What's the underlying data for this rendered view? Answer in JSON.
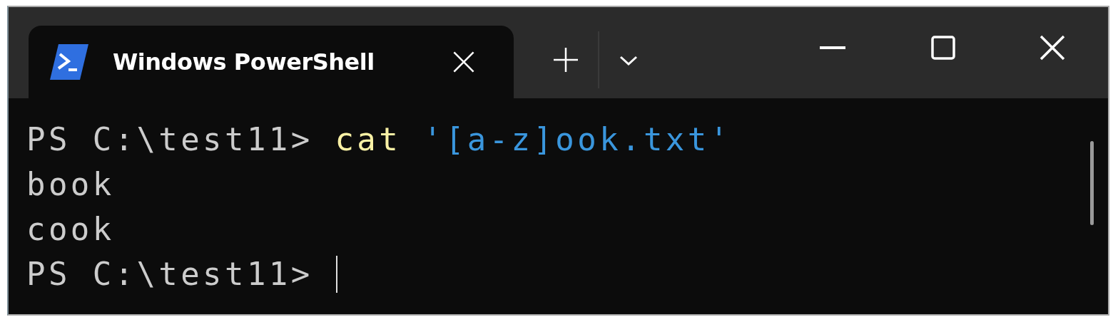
{
  "tab": {
    "title": "Windows PowerShell",
    "selected": true
  },
  "terminal": {
    "lines": [
      {
        "segments": [
          {
            "kind": "prompt",
            "text": "PS C:\\test11> "
          },
          {
            "kind": "command",
            "text": "cat "
          },
          {
            "kind": "string",
            "text": "'[a-z]ook.txt'"
          }
        ],
        "cursor": false
      },
      {
        "segments": [
          {
            "kind": "output",
            "text": "book"
          }
        ],
        "cursor": false
      },
      {
        "segments": [
          {
            "kind": "output",
            "text": "cook"
          }
        ],
        "cursor": false
      },
      {
        "segments": [
          {
            "kind": "prompt",
            "text": "PS C:\\test11> "
          }
        ],
        "cursor": true
      }
    ]
  }
}
